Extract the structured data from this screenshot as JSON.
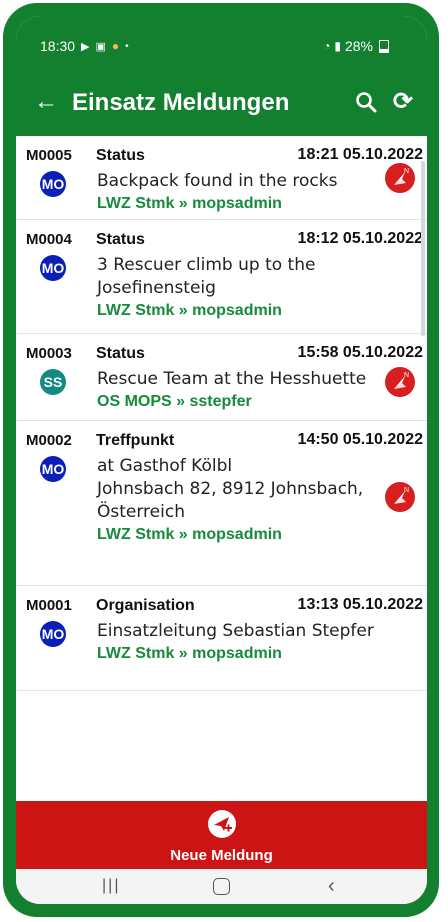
{
  "status_bar": {
    "time": "18:30",
    "battery": "28%"
  },
  "app_bar": {
    "title": "Einsatz Meldungen",
    "back_icon": "arrow-left-icon",
    "search_icon": "search-icon",
    "refresh_icon": "refresh-icon"
  },
  "messages": [
    {
      "id": "M0005",
      "type": "Status",
      "time": "18:21 05.10.2022",
      "avatar": "MO",
      "avatar_color": "#0a1fb8",
      "lines": [
        "Backpack found in the rocks"
      ],
      "source": "LWZ Stmk » mopsadmin",
      "has_location": true
    },
    {
      "id": "M0004",
      "type": "Status",
      "time": "18:12 05.10.2022",
      "avatar": "MO",
      "avatar_color": "#0a1fb8",
      "lines": [
        "3 Rescuer climb up to the",
        "Josefinensteig"
      ],
      "source": "LWZ Stmk » mopsadmin",
      "has_location": false
    },
    {
      "id": "M0003",
      "type": "Status",
      "time": "15:58 05.10.2022",
      "avatar": "SS",
      "avatar_color": "#138a84",
      "lines": [
        "Rescue Team at the Hesshuette"
      ],
      "source": "OS MOPS  » sstepfer",
      "has_location": true
    },
    {
      "id": "M0002",
      "type": "Treffpunkt",
      "time": "14:50 05.10.2022",
      "avatar": "MO",
      "avatar_color": "#0a1fb8",
      "lines": [
        "at Gasthof Kölbl",
        "Johnsbach 82, 8912 Johnsbach,",
        "Österreich"
      ],
      "source": "LWZ Stmk » mopsadmin",
      "has_location": true
    },
    {
      "id": "M0001",
      "type": "Organisation",
      "time": "13:13 05.10.2022",
      "avatar": "MO",
      "avatar_color": "#0a1fb8",
      "lines": [
        "Einsatzleitung Sebastian Stepfer"
      ],
      "source": "LWZ Stmk » mopsadmin",
      "has_location": false
    }
  ],
  "new_message_button": {
    "label": "Neue Meldung",
    "icon": "paper-plane-plus-icon"
  },
  "colors": {
    "primary": "#12802e",
    "accent_red": "#cc1414",
    "source_green": "#178a3c"
  }
}
